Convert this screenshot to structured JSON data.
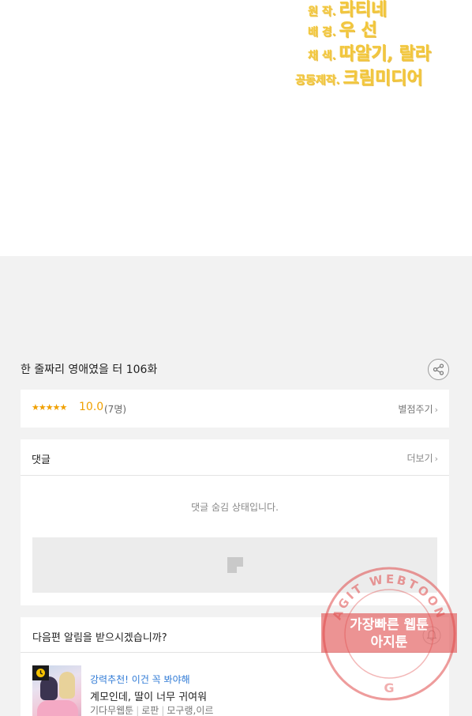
{
  "credits": [
    {
      "role": "원 작.",
      "names": "라티네"
    },
    {
      "role": "배 경.",
      "names": "우 선"
    },
    {
      "role": "채 색.",
      "names": "따알기, 랄라"
    },
    {
      "role": "공동제작.",
      "names": "크림미디어"
    }
  ],
  "episode": {
    "title": "한 줄짜리 영애였을 터 106화"
  },
  "rating": {
    "stars": "★★★★★",
    "score": "10.0",
    "count": "(7명)",
    "rate_label": "별점주기"
  },
  "comments": {
    "title": "댓글",
    "more_label": "더보기",
    "hidden_message": "댓글 숨김 상태입니다."
  },
  "next_episode": {
    "prompt": "다음편 알림을 받으시겠습니까?"
  },
  "recommendation": {
    "tag": "강력추천! 이건 꼭 봐야해",
    "title": "계모인데, 딸이 너무 귀여워",
    "meta": [
      "기다무웹툰",
      "로판",
      "모구랭,이르"
    ]
  },
  "watermark": {
    "ring_text": "AGIT WEBTOON",
    "line1": "가장빠른 웹툰",
    "line2": "아지툰"
  },
  "colors": {
    "accent_orange": "#f0a000",
    "link_blue": "#2f7ad6",
    "credit_gold": "#f2c63a",
    "stamp_red": "#e04b4b"
  }
}
